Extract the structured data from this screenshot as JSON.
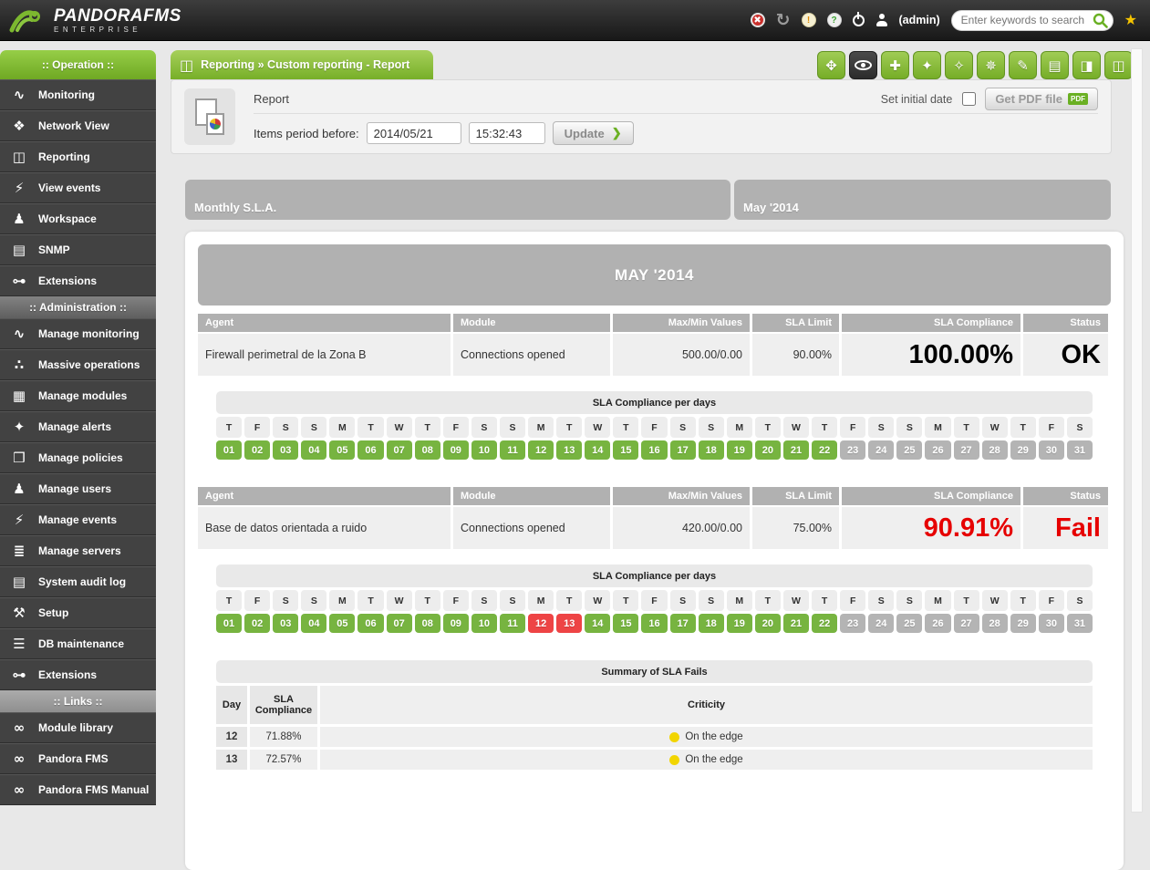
{
  "header": {
    "brand": "PANDORAFMS",
    "brand_sub": "ENTERPRISE",
    "user": "(admin)",
    "search_placeholder": "Enter keywords to search",
    "icons": [
      "error-icon",
      "refresh-icon",
      "warning-icon",
      "help-icon",
      "logout-icon",
      "user-icon",
      "search-icon",
      "favorites-star-icon"
    ]
  },
  "sidebar": {
    "sections": [
      {
        "title": ":: Operation ::",
        "style": "green",
        "items": [
          {
            "id": "monitoring",
            "label": "Monitoring",
            "glyph": "∿"
          },
          {
            "id": "network-view",
            "label": "Network View",
            "glyph": "❖"
          },
          {
            "id": "reporting",
            "label": "Reporting",
            "glyph": "◫"
          },
          {
            "id": "view-events",
            "label": "View events",
            "glyph": "⚡"
          },
          {
            "id": "workspace",
            "label": "Workspace",
            "glyph": "♟"
          },
          {
            "id": "snmp",
            "label": "SNMP",
            "glyph": "▤"
          },
          {
            "id": "extensions",
            "label": "Extensions",
            "glyph": "⊶"
          }
        ]
      },
      {
        "title": ":: Administration ::",
        "style": "gray",
        "items": [
          {
            "id": "manage-monitoring",
            "label": "Manage monitoring",
            "glyph": "∿"
          },
          {
            "id": "massive-operations",
            "label": "Massive operations",
            "glyph": "∴"
          },
          {
            "id": "manage-modules",
            "label": "Manage modules",
            "glyph": "▦"
          },
          {
            "id": "manage-alerts",
            "label": "Manage alerts",
            "glyph": "✦"
          },
          {
            "id": "manage-policies",
            "label": "Manage policies",
            "glyph": "❒"
          },
          {
            "id": "manage-users",
            "label": "Manage users",
            "glyph": "♟"
          },
          {
            "id": "manage-events",
            "label": "Manage events",
            "glyph": "⚡"
          },
          {
            "id": "manage-servers",
            "label": "Manage servers",
            "glyph": "≣"
          },
          {
            "id": "system-audit-log",
            "label": "System audit log",
            "glyph": "▤"
          },
          {
            "id": "setup",
            "label": "Setup",
            "glyph": "⚒"
          },
          {
            "id": "db-maintenance",
            "label": "DB maintenance",
            "glyph": "☰"
          },
          {
            "id": "extensions-admin",
            "label": "Extensions",
            "glyph": "⊶"
          }
        ]
      },
      {
        "title": ":: Links ::",
        "style": "links",
        "items": [
          {
            "id": "module-library",
            "label": "Module library",
            "glyph": "∞"
          },
          {
            "id": "pandora-fms",
            "label": "Pandora FMS",
            "glyph": "∞"
          },
          {
            "id": "pandora-fms-manual",
            "label": "Pandora FMS Manual",
            "glyph": "∞"
          }
        ]
      }
    ]
  },
  "breadcrumb": "Reporting » Custom reporting - Report",
  "toolbar": {
    "buttons": [
      {
        "id": "fullscreen",
        "icon": "fullscreen-icon",
        "glyph": "✥",
        "active": false
      },
      {
        "id": "view-report",
        "icon": "eye-icon",
        "glyph": "eye",
        "active": true
      },
      {
        "id": "add-item",
        "icon": "add-page-icon",
        "glyph": "✚",
        "active": false
      },
      {
        "id": "wizard",
        "icon": "wand-icon",
        "glyph": "✦",
        "active": false
      },
      {
        "id": "sla-wizard",
        "icon": "wand-pin-icon",
        "glyph": "✧",
        "active": false
      },
      {
        "id": "advanced-wizard",
        "icon": "sparkle-wand-icon",
        "glyph": "✵",
        "active": false
      },
      {
        "id": "edit",
        "icon": "pencil-icon",
        "glyph": "✎",
        "active": false
      },
      {
        "id": "list-items",
        "icon": "list-icon",
        "glyph": "▤",
        "active": false
      },
      {
        "id": "report-chart-1",
        "icon": "page-chart-icon",
        "glyph": "◨",
        "active": false
      },
      {
        "id": "report-chart-2",
        "icon": "page-chart-icon",
        "glyph": "◫",
        "active": false
      }
    ]
  },
  "report_form": {
    "title": "Report",
    "set_initial_date_label": "Set initial date",
    "get_pdf_label": "Get PDF file",
    "pdf_badge": "PDF",
    "items_period_label": "Items period before:",
    "date_value": "2014/05/21",
    "time_value": "15:32:43",
    "update_label": "Update",
    "update_arrow": "❯"
  },
  "report": {
    "item_title": "Monthly S.L.A.",
    "item_period": "May '2014",
    "month_header": "MAY '2014",
    "sla_tables": [
      {
        "columns": [
          "Agent",
          "Module",
          "Max/Min Values",
          "SLA Limit",
          "SLA Compliance",
          "Status"
        ],
        "agent": "Firewall perimetral de la Zona B",
        "module": "Connections opened",
        "max_min": "500.00/0.00",
        "sla_limit": "90.00%",
        "sla_compliance": "100.00%",
        "status": "OK",
        "status_color": "#000000",
        "days_title": "SLA Compliance per days",
        "weekdays": [
          "T",
          "F",
          "S",
          "S",
          "M",
          "T",
          "W",
          "T",
          "F",
          "S",
          "S",
          "M",
          "T",
          "W",
          "T",
          "F",
          "S",
          "S",
          "M",
          "T",
          "W",
          "T",
          "F",
          "S",
          "S",
          "M",
          "T",
          "W",
          "T",
          "F",
          "S"
        ],
        "days": [
          [
            "01",
            "ok"
          ],
          [
            "02",
            "ok"
          ],
          [
            "03",
            "ok"
          ],
          [
            "04",
            "ok"
          ],
          [
            "05",
            "ok"
          ],
          [
            "06",
            "ok"
          ],
          [
            "07",
            "ok"
          ],
          [
            "08",
            "ok"
          ],
          [
            "09",
            "ok"
          ],
          [
            "10",
            "ok"
          ],
          [
            "11",
            "ok"
          ],
          [
            "12",
            "ok"
          ],
          [
            "13",
            "ok"
          ],
          [
            "14",
            "ok"
          ],
          [
            "15",
            "ok"
          ],
          [
            "16",
            "ok"
          ],
          [
            "17",
            "ok"
          ],
          [
            "18",
            "ok"
          ],
          [
            "19",
            "ok"
          ],
          [
            "20",
            "ok"
          ],
          [
            "21",
            "ok"
          ],
          [
            "22",
            "ok"
          ],
          [
            "23",
            "unknown"
          ],
          [
            "24",
            "unknown"
          ],
          [
            "25",
            "unknown"
          ],
          [
            "26",
            "unknown"
          ],
          [
            "27",
            "unknown"
          ],
          [
            "28",
            "unknown"
          ],
          [
            "29",
            "unknown"
          ],
          [
            "30",
            "unknown"
          ],
          [
            "31",
            "unknown"
          ]
        ]
      },
      {
        "columns": [
          "Agent",
          "Module",
          "Max/Min Values",
          "SLA Limit",
          "SLA Compliance",
          "Status"
        ],
        "agent": "Base de datos orientada a ruido",
        "module": "Connections opened",
        "max_min": "420.00/0.00",
        "sla_limit": "75.00%",
        "sla_compliance": "90.91%",
        "status": "Fail",
        "status_color": "#e60000",
        "days_title": "SLA Compliance per days",
        "weekdays": [
          "T",
          "F",
          "S",
          "S",
          "M",
          "T",
          "W",
          "T",
          "F",
          "S",
          "S",
          "M",
          "T",
          "W",
          "T",
          "F",
          "S",
          "S",
          "M",
          "T",
          "W",
          "T",
          "F",
          "S",
          "S",
          "M",
          "T",
          "W",
          "T",
          "F",
          "S"
        ],
        "days": [
          [
            "01",
            "ok"
          ],
          [
            "02",
            "ok"
          ],
          [
            "03",
            "ok"
          ],
          [
            "04",
            "ok"
          ],
          [
            "05",
            "ok"
          ],
          [
            "06",
            "ok"
          ],
          [
            "07",
            "ok"
          ],
          [
            "08",
            "ok"
          ],
          [
            "09",
            "ok"
          ],
          [
            "10",
            "ok"
          ],
          [
            "11",
            "ok"
          ],
          [
            "12",
            "fail"
          ],
          [
            "13",
            "fail"
          ],
          [
            "14",
            "ok"
          ],
          [
            "15",
            "ok"
          ],
          [
            "16",
            "ok"
          ],
          [
            "17",
            "ok"
          ],
          [
            "18",
            "ok"
          ],
          [
            "19",
            "ok"
          ],
          [
            "20",
            "ok"
          ],
          [
            "21",
            "ok"
          ],
          [
            "22",
            "ok"
          ],
          [
            "23",
            "unknown"
          ],
          [
            "24",
            "unknown"
          ],
          [
            "25",
            "unknown"
          ],
          [
            "26",
            "unknown"
          ],
          [
            "27",
            "unknown"
          ],
          [
            "28",
            "unknown"
          ],
          [
            "29",
            "unknown"
          ],
          [
            "30",
            "unknown"
          ],
          [
            "31",
            "unknown"
          ]
        ]
      }
    ],
    "summary": {
      "title": "Summary of SLA Fails",
      "columns": [
        "Day",
        "SLA Compliance",
        "Criticity"
      ],
      "rows": [
        {
          "day": "12",
          "compliance": "71.88%",
          "criticity": "On the edge",
          "dot_color": "#f2d500"
        },
        {
          "day": "13",
          "compliance": "72.57%",
          "criticity": "On the edge",
          "dot_color": "#f2d500"
        }
      ]
    }
  },
  "colors": {
    "accent_green": "#7eb12c",
    "day_ok": "#77b440",
    "day_fail": "#ee4445",
    "day_unknown": "#b4b4b4",
    "status_ok_text": "#000000",
    "status_fail_text": "#e60000",
    "criticity_yellow": "#f2d500",
    "header_gray": "#b1b1b1"
  }
}
